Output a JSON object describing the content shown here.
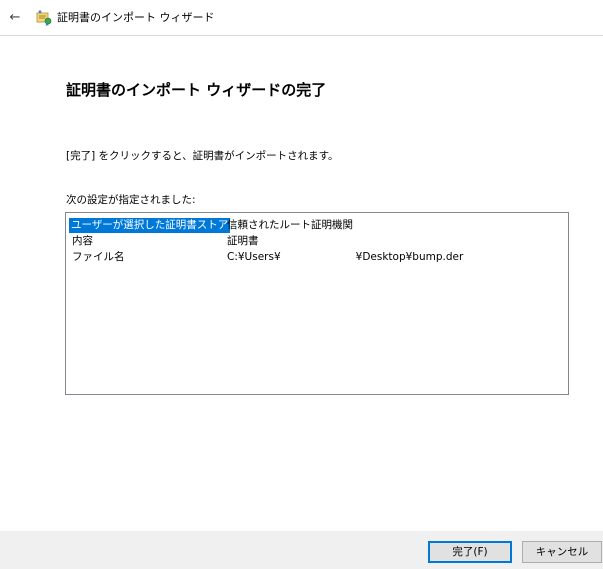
{
  "window": {
    "title": "証明書のインポート ウィザード"
  },
  "page": {
    "heading": "証明書のインポート ウィザードの完了",
    "description": "[完了] をクリックすると、証明書がインポートされます。",
    "settings_label": "次の設定が指定されました:"
  },
  "settings": {
    "rows": [
      {
        "key": "ユーザーが選択した証明書ストア",
        "value": "信頼されたルート証明機関",
        "selected": true
      },
      {
        "key": "内容",
        "value": "証明書",
        "selected": false
      },
      {
        "key": "ファイル名",
        "value_prefix": "C:¥Users¥",
        "value_suffix": "¥Desktop¥bump.der",
        "selected": false
      }
    ]
  },
  "footer": {
    "finish_label": "完了(F)",
    "cancel_label": "キャンセル"
  },
  "icons": {
    "back": "back-arrow-icon",
    "app": "certificate-wizard-icon"
  },
  "colors": {
    "selection": "#0078d7",
    "footer_bg": "#f0f0f0",
    "button_bg": "#e1e1e1",
    "primary_border": "#0078d7"
  }
}
